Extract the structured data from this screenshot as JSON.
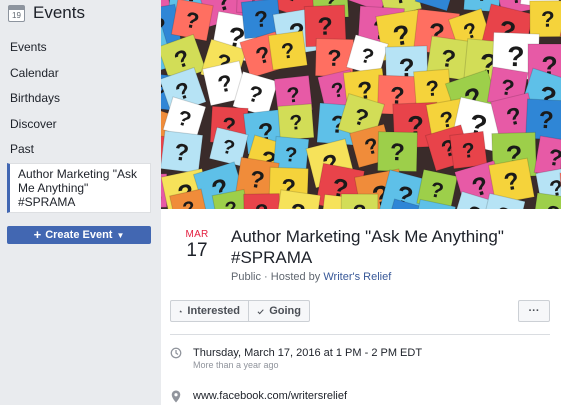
{
  "sidebar": {
    "calendar_icon_day": "19",
    "title": "Events",
    "nav": [
      "Events",
      "Calendar",
      "Birthdays",
      "Discover",
      "Past"
    ],
    "active_item": "Author Marketing \"Ask Me Anything\" #SPRAMA",
    "create_button": "Create Event",
    "accent_color": "#4267b2"
  },
  "event": {
    "date_month": "MAR",
    "date_day": "17",
    "title": "Author Marketing \"Ask Me Anything\" #SPRAMA",
    "privacy": "Public",
    "hosted_by_prefix": "Hosted by",
    "host": "Writer's Relief",
    "interested_label": "Interested",
    "going_label": "Going",
    "more_label": "···",
    "datetime": "Thursday, March 17, 2016 at 1 PM - 2 PM EDT",
    "relative_time": "More than a year ago",
    "location": "www.facebook.com/writersrelief"
  },
  "icons": {
    "calendar": "calendar-icon",
    "star": "star-icon",
    "check": "check-icon",
    "clock": "clock-icon",
    "pin": "location-pin-icon",
    "plus": "plus-icon",
    "caret": "caret-down-icon"
  }
}
